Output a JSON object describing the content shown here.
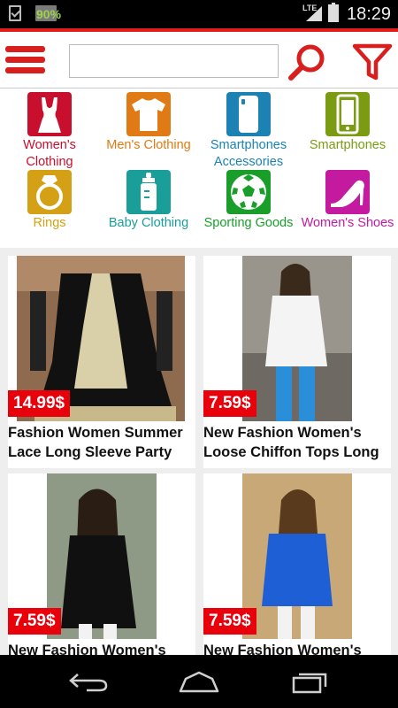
{
  "status_bar": {
    "battery_badge": "90%",
    "network": "LTE",
    "time": "18:29"
  },
  "toolbar": {
    "search_placeholder": "",
    "search_value": ""
  },
  "categories": [
    {
      "label": "Women's Clothing",
      "color": "#c8102e",
      "icon": "dress-icon"
    },
    {
      "label": "Men's Clothing",
      "color": "#e07a15",
      "icon": "tshirt-icon"
    },
    {
      "label": "Smartphones Accessories",
      "color": "#1b82b3",
      "icon": "phone-case-icon"
    },
    {
      "label": "Smartphones",
      "color": "#7a9b12",
      "icon": "smartphone-icon"
    },
    {
      "label": "Rings",
      "color": "#d4a015",
      "icon": "ring-icon"
    },
    {
      "label": "Baby Clothing",
      "color": "#1a9e9a",
      "icon": "baby-bottle-icon"
    },
    {
      "label": "Sporting Goods",
      "color": "#1a9e2a",
      "icon": "soccer-ball-icon"
    },
    {
      "label": "Women's Shoes",
      "color": "#c41aa0",
      "icon": "high-heel-icon"
    }
  ],
  "products": [
    {
      "price": "14.99$",
      "title": "Fashion Women Summer Lace Long Sleeve Party"
    },
    {
      "price": "7.59$",
      "title": "New Fashion Women's Loose Chiffon Tops Long"
    },
    {
      "price": "7.59$",
      "title": "New Fashion Women's"
    },
    {
      "price": "7.59$",
      "title": "New Fashion Women's"
    }
  ],
  "colors": {
    "accent": "#d91e1e",
    "price_badge": "#e8000b"
  }
}
